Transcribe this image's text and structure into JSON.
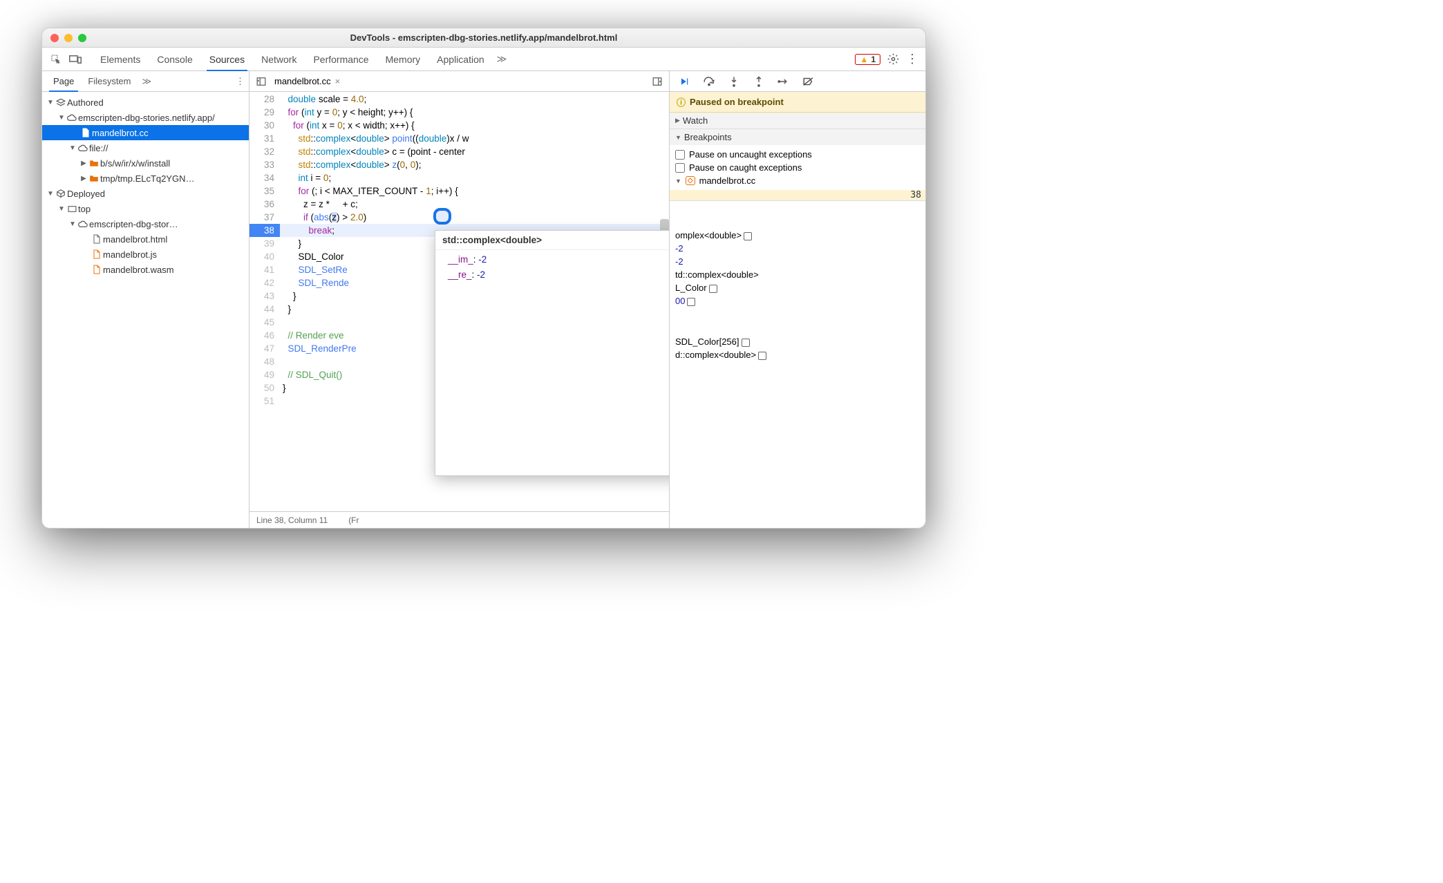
{
  "title": "DevTools - emscripten-dbg-stories.netlify.app/mandelbrot.html",
  "mainTabs": [
    "Elements",
    "Console",
    "Sources",
    "Network",
    "Performance",
    "Memory",
    "Application"
  ],
  "mainTabActive": 2,
  "warningCount": "1",
  "navTabs": [
    "Page",
    "Filesystem"
  ],
  "navTabActive": 0,
  "tree": {
    "authored": "Authored",
    "cloud1": "emscripten-dbg-stories.netlify.app/",
    "file": "mandelbrot.cc",
    "fileScheme": "file://",
    "folder1": "b/s/w/ir/x/w/install",
    "folder2": "tmp/tmp.ELcTq2YGN…",
    "deployed": "Deployed",
    "top": "top",
    "cloud2": "emscripten-dbg-stor…",
    "f_html": "mandelbrot.html",
    "f_js": "mandelbrot.js",
    "f_wasm": "mandelbrot.wasm"
  },
  "editorTab": "mandelbrot.cc",
  "lines": [
    {
      "n": "28",
      "dim": false,
      "html": "  <span class='ty'>double</span> scale = <span class='nm'>4.0</span>;"
    },
    {
      "n": "29",
      "dim": false,
      "html": "  <span class='kw'>for</span> (<span class='ty'>int</span> y = <span class='nm'>0</span>; y &lt; height; y++) {"
    },
    {
      "n": "30",
      "dim": false,
      "html": "    <span class='kw'>for</span> (<span class='ty'>int</span> x = <span class='nm'>0</span>; x &lt; width; x++) {"
    },
    {
      "n": "31",
      "dim": false,
      "html": "      <span class='ns'>std</span>::<span class='ty'>complex</span>&lt;<span class='ty'>double</span>&gt; <span class='fn'>point</span>((<span class='ty'>double</span>)x / w"
    },
    {
      "n": "32",
      "dim": false,
      "html": "      <span class='ns'>std</span>::<span class='ty'>complex</span>&lt;<span class='ty'>double</span>&gt; c = (point - center"
    },
    {
      "n": "33",
      "dim": false,
      "html": "      <span class='ns'>std</span>::<span class='ty'>complex</span>&lt;<span class='ty'>double</span>&gt; <span class='fn'>z</span>(<span class='nm'>0</span>, <span class='nm'>0</span>);"
    },
    {
      "n": "34",
      "dim": false,
      "html": "      <span class='ty'>int</span> i = <span class='nm'>0</span>;"
    },
    {
      "n": "35",
      "dim": false,
      "html": "      <span class='kw'>for</span> (; i &lt; MAX_ITER_COUNT - <span class='nm'>1</span>; i++) {"
    },
    {
      "n": "36",
      "dim": false,
      "html": "        z = z *     + c;"
    },
    {
      "n": "37",
      "dim": false,
      "html": "        <span class='kw'>if</span> (<span class='fn'>abs</span>(<span style='background:#cdd9ff'>z</span>) &gt; <span class='nm'>2.0</span>)"
    },
    {
      "n": "38",
      "dim": false,
      "bp": true,
      "hl": true,
      "html": "          <span class='br'>break</span>;"
    },
    {
      "n": "39",
      "dim": true,
      "html": "      }"
    },
    {
      "n": "40",
      "dim": true,
      "html": "      SDL_Color"
    },
    {
      "n": "41",
      "dim": true,
      "html": "      <span class='fn'>SDL_SetRe</span>"
    },
    {
      "n": "42",
      "dim": true,
      "html": "      <span class='fn'>SDL_Rende</span>"
    },
    {
      "n": "43",
      "dim": true,
      "html": "    }"
    },
    {
      "n": "44",
      "dim": true,
      "html": "  }"
    },
    {
      "n": "45",
      "dim": true,
      "html": ""
    },
    {
      "n": "46",
      "dim": true,
      "html": "  <span class='cm'>// Render eve</span>"
    },
    {
      "n": "47",
      "dim": true,
      "html": "  <span class='fn'>SDL_RenderPre</span>"
    },
    {
      "n": "48",
      "dim": true,
      "html": ""
    },
    {
      "n": "49",
      "dim": true,
      "html": "  <span class='cm'>// SDL_Quit()</span>"
    },
    {
      "n": "50",
      "dim": true,
      "html": "}"
    },
    {
      "n": "51",
      "dim": true,
      "html": ""
    }
  ],
  "tooltip": {
    "header": "std::complex<double>",
    "rows": [
      {
        "k": "__im_",
        "v": "-2"
      },
      {
        "k": "__re_",
        "v": "-2"
      }
    ]
  },
  "status": {
    "pos": "Line 38, Column 11",
    "cov": "(Fr"
  },
  "paused": "Paused on breakpoint",
  "watch": "Watch",
  "breakpoints": {
    "title": "Breakpoints",
    "uncaught": "Pause on uncaught exceptions",
    "caught": "Pause on caught exceptions",
    "file": "mandelbrot.cc",
    "line": "38"
  },
  "scope": [
    "omplex<double>",
    "-2",
    "-2",
    "td::complex<double>",
    "L_Color",
    "00",
    "SDL_Color[256]",
    "d::complex<double>"
  ]
}
